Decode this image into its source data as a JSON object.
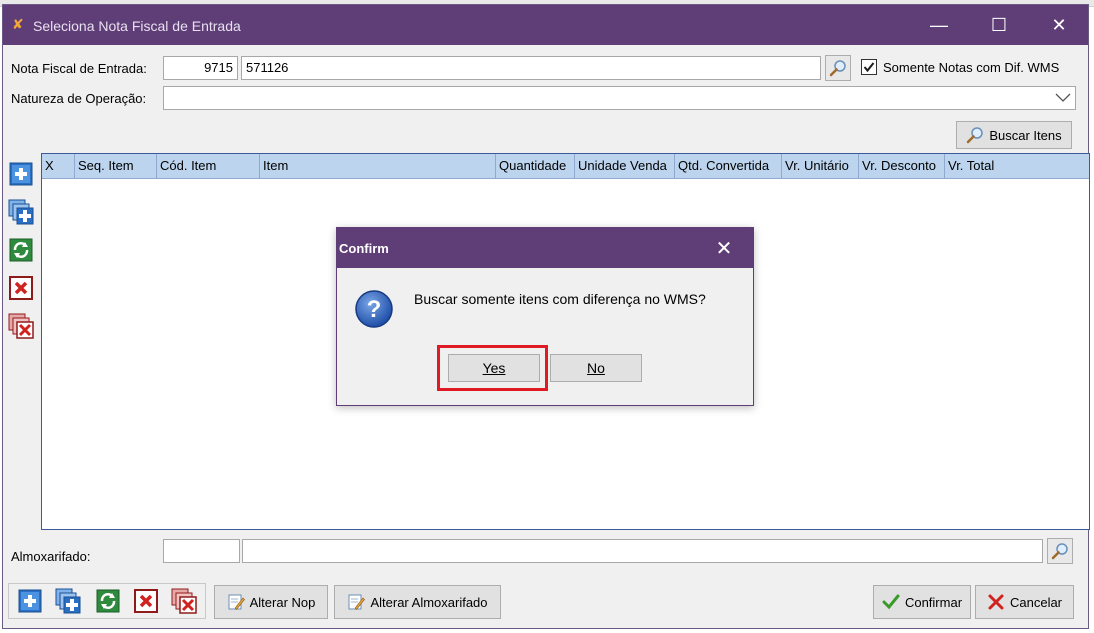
{
  "window": {
    "title": "Seleciona Nota Fiscal de Entrada",
    "minimize_glyph": "—",
    "maximize_glyph": "☐",
    "close_glyph": "✕"
  },
  "form": {
    "nf_label": "Nota Fiscal de Entrada:",
    "nf_code": "9715",
    "nf_name": "571126",
    "somente_notas_label": "Somente Notas com Dif. WMS",
    "somente_notas_checked": true,
    "natureza_label": "Natureza de Operação:",
    "natureza_value": "",
    "buscar_itens_label": "Buscar Itens"
  },
  "grid": {
    "columns": [
      "X",
      "Seq. Item",
      "Cód. Item",
      "Item",
      "Quantidade",
      "Unidade Venda",
      "Qtd. Convertida",
      "Vr. Unitário",
      "Vr. Desconto",
      "Vr. Total"
    ],
    "rows": []
  },
  "side_toolbar": {
    "icons": [
      "add-item-icon",
      "add-multiple-icon",
      "refresh-icon",
      "delete-item-icon",
      "delete-multiple-icon"
    ]
  },
  "bottom": {
    "almoxarifado_label": "Almoxarifado:",
    "almoxarifado_code": "",
    "almoxarifado_name": "",
    "alterar_nop_label": "Alterar Nop",
    "alterar_almox_label": "Alterar Almoxarifado",
    "confirmar_label": "Confirmar",
    "cancelar_label": "Cancelar"
  },
  "dialog": {
    "title": "Confirm",
    "message": "Buscar somente itens com diferença no WMS?",
    "yes_label": "Yes",
    "no_label": "No"
  },
  "colors": {
    "titlebar": "#5f3e78",
    "grid_header": "#bcd4ee",
    "highlight": "#e01b24"
  }
}
